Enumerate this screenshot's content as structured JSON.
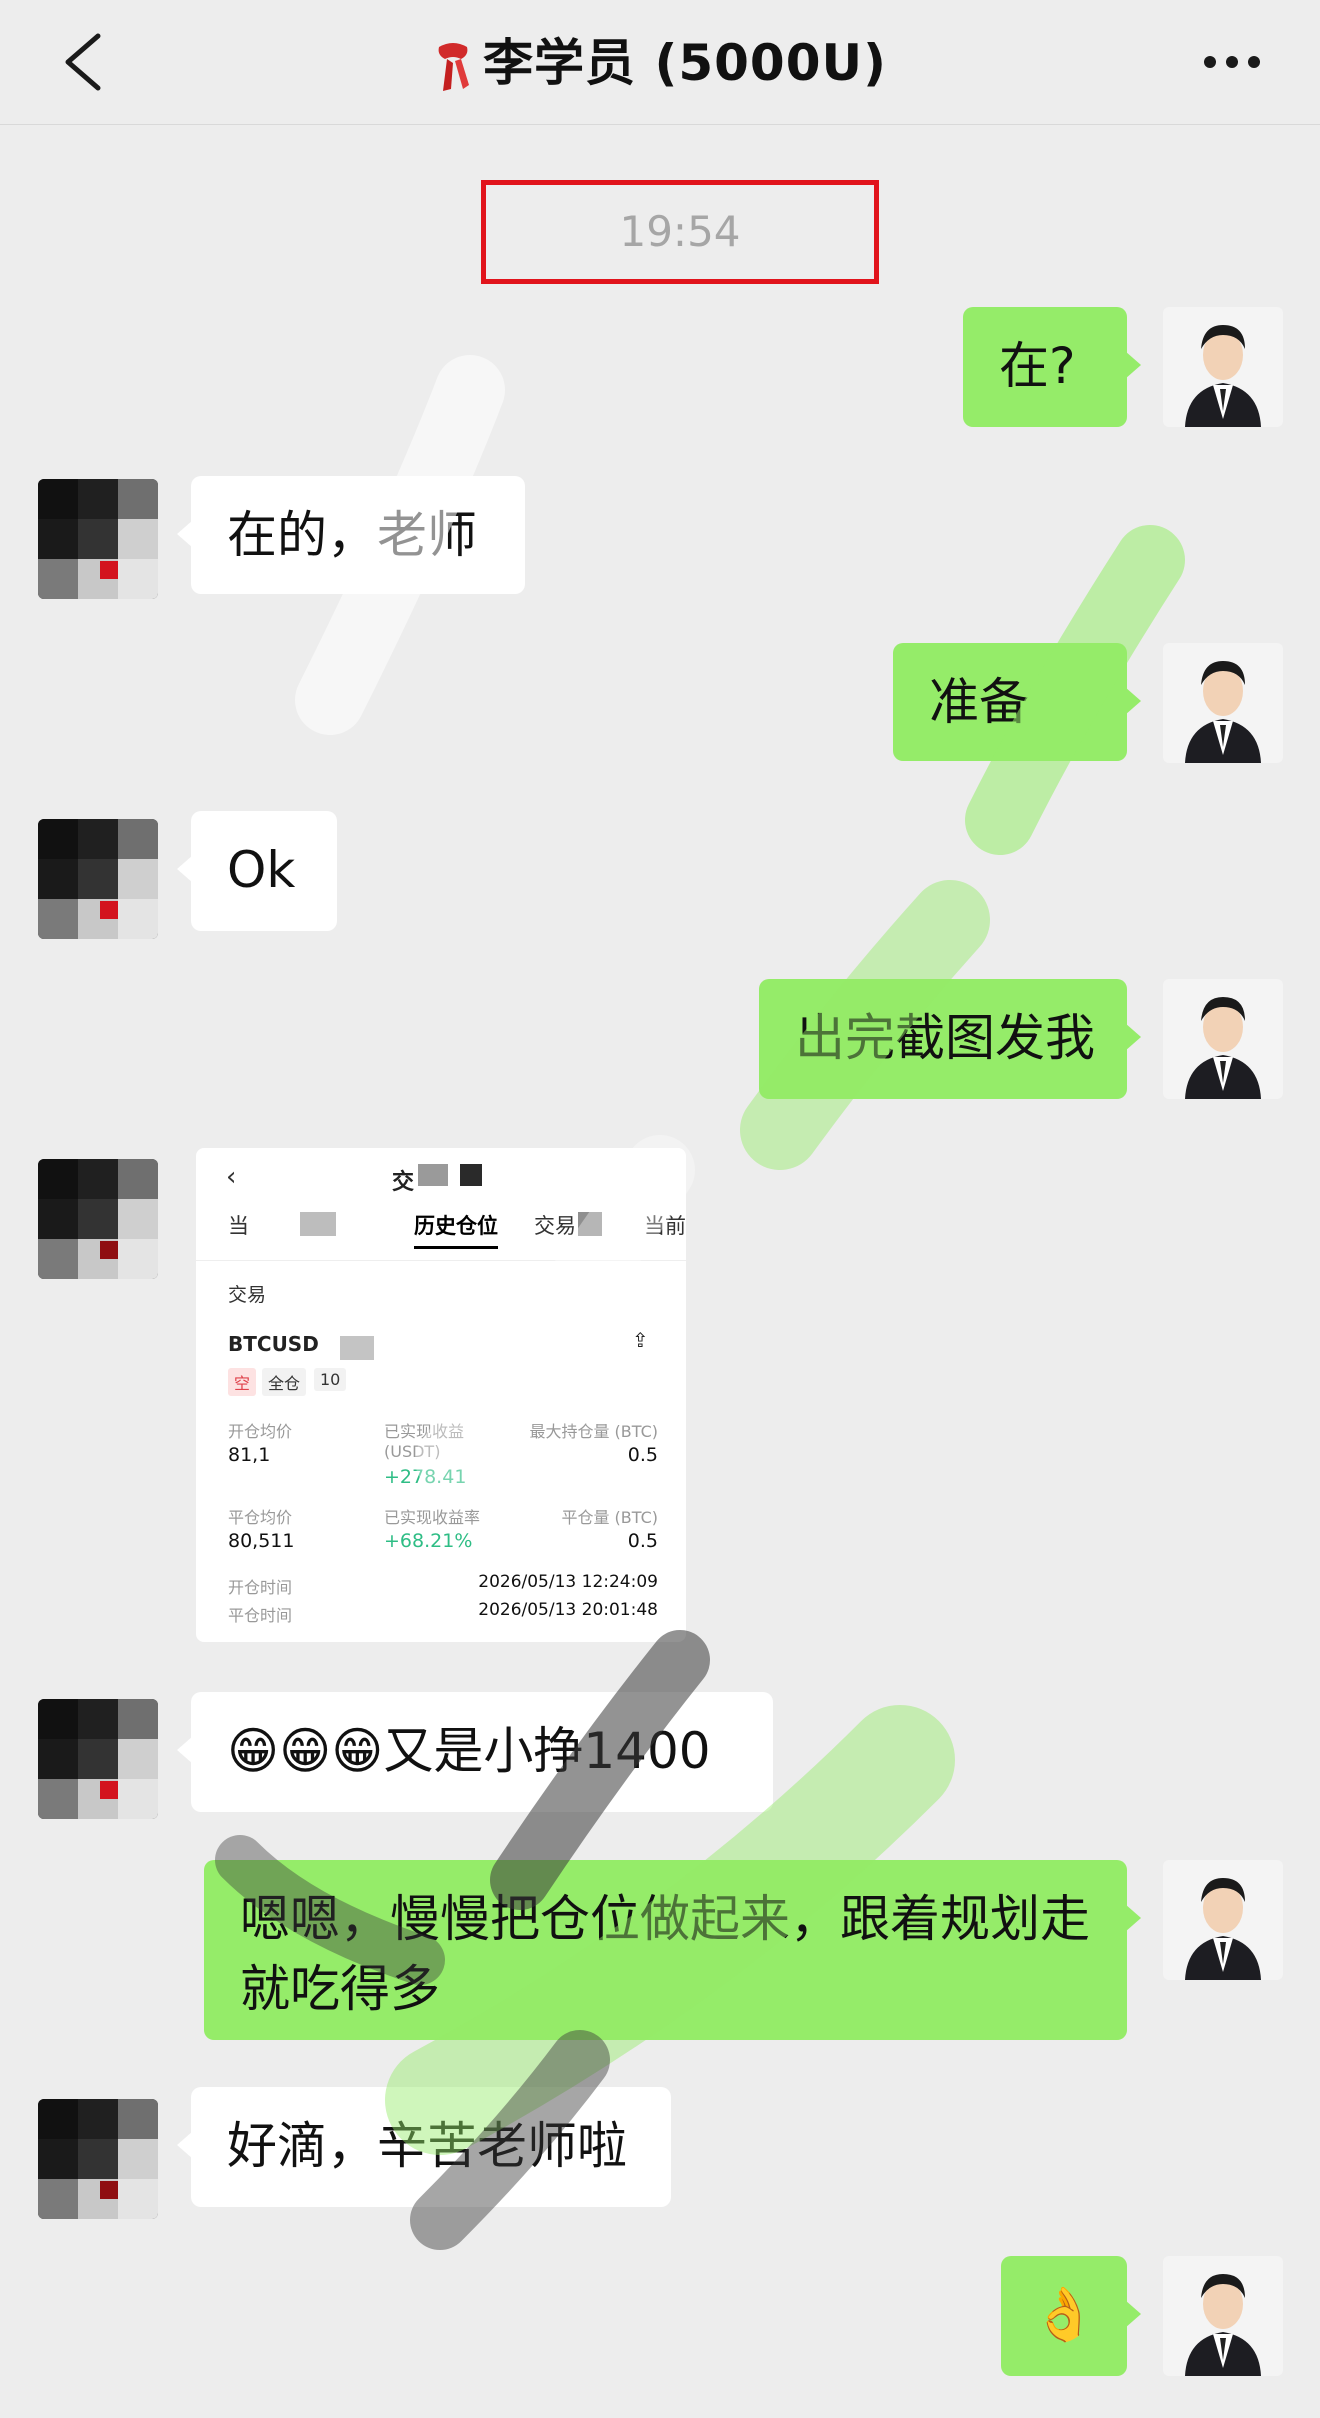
{
  "header": {
    "title": "李学员 (5000U)",
    "back_icon": "chevron-left-icon",
    "more_icon": "more-dots-icon",
    "title_icon": "red-scarf-icon"
  },
  "timestamp": "19:54",
  "messages": [
    {
      "side": "me",
      "text": "在?"
    },
    {
      "side": "other",
      "text": "在的，老师"
    },
    {
      "side": "me",
      "text": "准备"
    },
    {
      "side": "other",
      "text": "Ok"
    },
    {
      "side": "me",
      "text": "出完截图发我"
    },
    {
      "side": "other",
      "type": "image"
    },
    {
      "side": "other",
      "text": "😁😁😁又是小挣1400"
    },
    {
      "side": "me",
      "text": "嗯嗯，慢慢把仓位做起来，跟着规划走就吃得多"
    },
    {
      "side": "other",
      "text": "好滴，辛苦老师啦"
    },
    {
      "side": "me",
      "text": "👌"
    }
  ],
  "screenshot": {
    "back": "‹",
    "title": "交",
    "tabs": [
      "当",
      "历史仓位",
      "交易",
      "当前"
    ],
    "filter": "交易",
    "pair": "BTCUSD",
    "tag_short": "空",
    "tag_margin": "全仓",
    "tag_leverage": "10",
    "open_avg_label": "开仓均价",
    "open_avg_value": "81,1",
    "realized_pnl_label": "已实现收益 (USDT)",
    "realized_pnl_value": "+278.41",
    "max_pos_label": "最大持仓量 (BTC)",
    "max_pos_value": "0.5",
    "close_avg_label": "平仓均价",
    "close_avg_value": "80,511",
    "realized_rate_label": "已实现收益率",
    "realized_rate_value": "+68.21%",
    "close_qty_label": "平仓量 (BTC)",
    "close_qty_value": "0.5",
    "open_time_label": "开仓时间",
    "open_time_value": "2026/05/13 12:24:09",
    "close_time_label": "平仓时间",
    "close_time_value": "2026/05/13 20:01:48"
  },
  "colors": {
    "background": "#ededed",
    "bubble_me": "#95ec69",
    "bubble_other": "#ffffff",
    "timestamp_frame": "#e1141c",
    "profit_green": "#2ebd85"
  }
}
